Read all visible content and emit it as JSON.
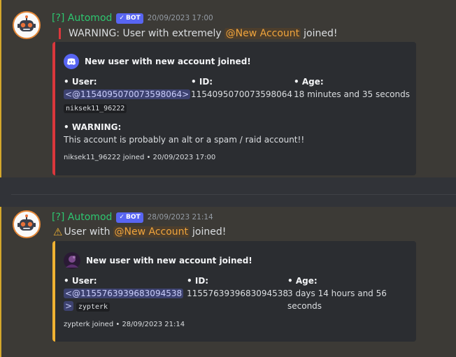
{
  "messages": [
    {
      "author": "[?] Automod",
      "bot_tag": "BOT",
      "timestamp": "20/09/2023 17:00",
      "content_prefix": "WARNING: User with extremely",
      "mention": "@New Account",
      "content_suffix": "joined!",
      "embed": {
        "color": "#da373c",
        "author": "New user with new account joined!",
        "user_label": "• User:",
        "user_ping": "<@1154095070073598064>",
        "user_tag": "niksek11_96222",
        "id_label": "• ID:",
        "id_value": "1154095070073598064",
        "age_label": "• Age:",
        "age_value": "18 minutes and 35 seconds",
        "warning_label": "• WARNING:",
        "warning_value": "This account is probably an alt or a spam / raid account!!",
        "footer": "niksek11_96222 joined • 20/09/2023 17:00"
      }
    },
    {
      "author": "[?] Automod",
      "bot_tag": "BOT",
      "timestamp": "28/09/2023 21:14",
      "content_prefix": "User with",
      "mention": "@New Account",
      "content_suffix": "joined!",
      "embed": {
        "color": "#f0b232",
        "author": "New user with new account joined!",
        "user_label": "• User:",
        "user_ping": "<@1155763939683094538",
        "user_ping_tail": ">",
        "user_tag": "zypterk",
        "id_label": "• ID:",
        "id_value": "1155763939683094538",
        "age_label": "• Age:",
        "age_value_1": "3 days 14 hours and 56",
        "age_value_2": "seconds",
        "footer": "zypterk joined • 28/09/2023 21:14"
      }
    }
  ]
}
